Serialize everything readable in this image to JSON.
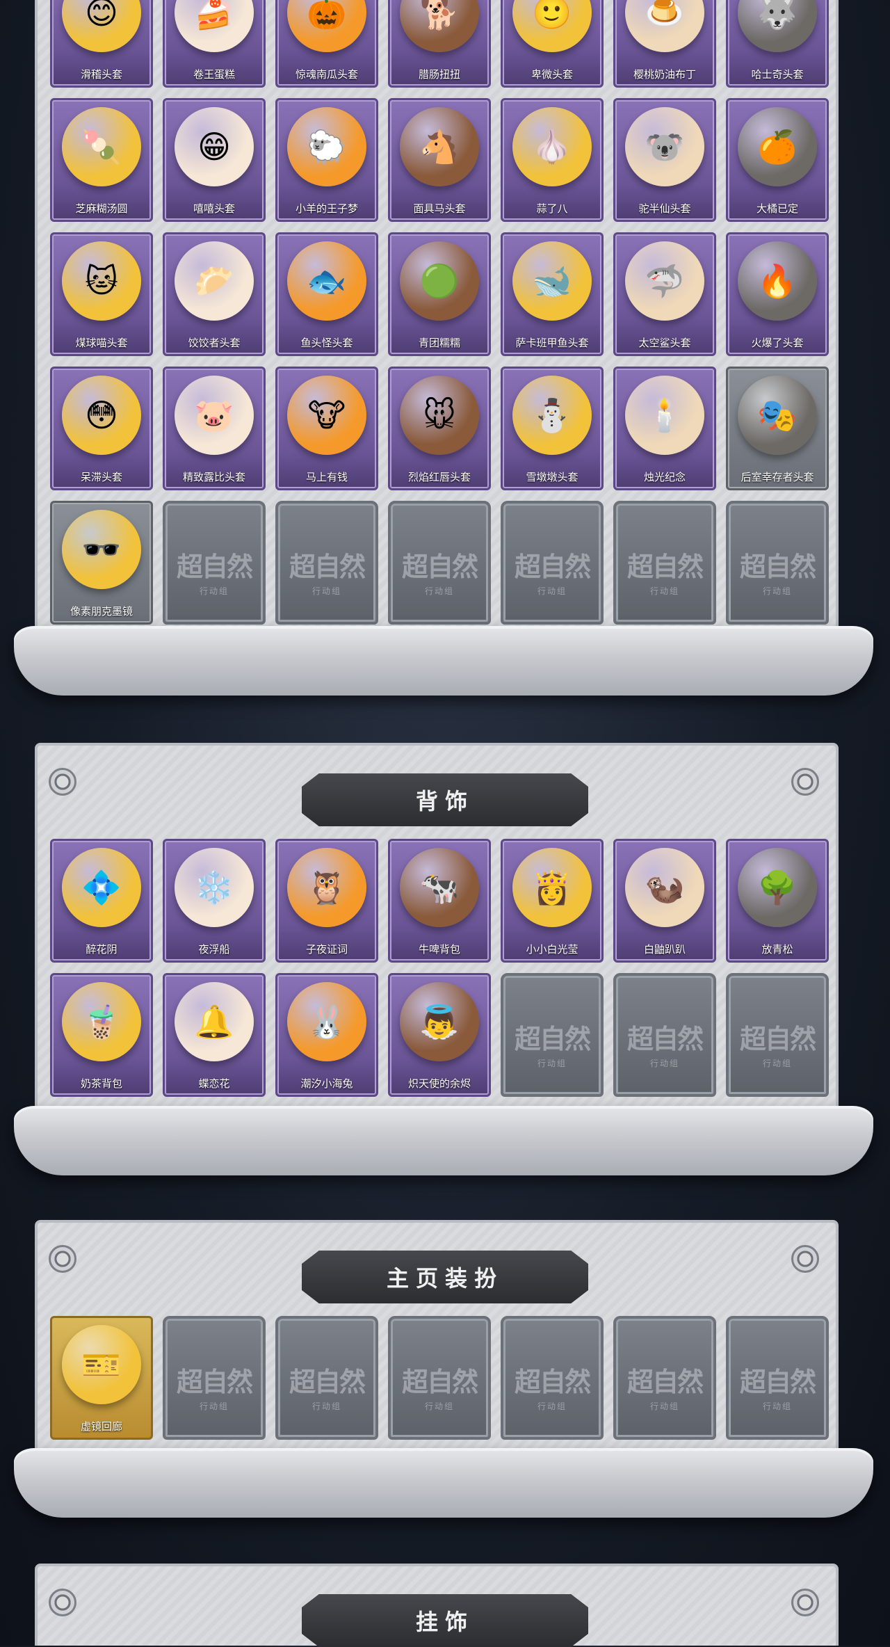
{
  "sections": {
    "backpack_title": "背饰",
    "homepage_title": "主页装扮",
    "pendant_title": "挂饰"
  },
  "watermark": {
    "main": "超自然",
    "sub": "行动组"
  },
  "headwear": [
    {
      "label": "滑稽头套",
      "icon": "😊",
      "style": "purple"
    },
    {
      "label": "卷王蛋糕",
      "icon": "🍰",
      "style": "purple"
    },
    {
      "label": "惊魂南瓜头套",
      "icon": "🎃",
      "style": "purple"
    },
    {
      "label": "腊肠扭扭",
      "icon": "🐕",
      "style": "purple"
    },
    {
      "label": "卑微头套",
      "icon": "🙂",
      "style": "purple"
    },
    {
      "label": "樱桃奶油布丁",
      "icon": "🍮",
      "style": "purple"
    },
    {
      "label": "哈士奇头套",
      "icon": "🐺",
      "style": "purple"
    },
    {
      "label": "芝麻糊汤圆",
      "icon": "🍡",
      "style": "purple"
    },
    {
      "label": "嘻嘻头套",
      "icon": "😁",
      "style": "purple"
    },
    {
      "label": "小羊的王子梦",
      "icon": "🐑",
      "style": "purple"
    },
    {
      "label": "面具马头套",
      "icon": "🐴",
      "style": "purple"
    },
    {
      "label": "蒜了八",
      "icon": "🧄",
      "style": "purple"
    },
    {
      "label": "驼半仙头套",
      "icon": "🐨",
      "style": "purple"
    },
    {
      "label": "大橘已定",
      "icon": "🍊",
      "style": "purple"
    },
    {
      "label": "煤球喵头套",
      "icon": "🐱",
      "style": "purple"
    },
    {
      "label": "饺饺者头套",
      "icon": "🥟",
      "style": "purple"
    },
    {
      "label": "鱼头怪头套",
      "icon": "🐟",
      "style": "purple"
    },
    {
      "label": "青团糯糯",
      "icon": "🟢",
      "style": "purple"
    },
    {
      "label": "萨卡班甲鱼头套",
      "icon": "🐋",
      "style": "purple"
    },
    {
      "label": "太空鲨头套",
      "icon": "🦈",
      "style": "purple"
    },
    {
      "label": "火爆了头套",
      "icon": "🔥",
      "style": "purple"
    },
    {
      "label": "呆滞头套",
      "icon": "😳",
      "style": "purple"
    },
    {
      "label": "精致露比头套",
      "icon": "🐷",
      "style": "purple"
    },
    {
      "label": "马上有钱",
      "icon": "🐮",
      "style": "purple"
    },
    {
      "label": "烈焰红唇头套",
      "icon": "🐭",
      "style": "purple"
    },
    {
      "label": "雪墩墩头套",
      "icon": "⛄",
      "style": "purple"
    },
    {
      "label": "烛光纪念",
      "icon": "🕯️",
      "style": "purple"
    },
    {
      "label": "后室幸存者头套",
      "icon": "🎭",
      "style": "gray"
    },
    {
      "label": "像素朋克墨镜",
      "icon": "🕶️",
      "style": "gray"
    }
  ],
  "backpack": [
    {
      "label": "醉花阴",
      "icon": "💠"
    },
    {
      "label": "夜浮船",
      "icon": "❄️"
    },
    {
      "label": "子夜证词",
      "icon": "🦉"
    },
    {
      "label": "牛啤背包",
      "icon": "🐄"
    },
    {
      "label": "小小白光莹",
      "icon": "👸"
    },
    {
      "label": "白鼬趴趴",
      "icon": "🦦"
    },
    {
      "label": "放青松",
      "icon": "🌳"
    },
    {
      "label": "奶茶背包",
      "icon": "🧋"
    },
    {
      "label": "蝶恋花",
      "icon": "🔔"
    },
    {
      "label": "潮汐小海兔",
      "icon": "🐰"
    },
    {
      "label": "炽天使的余烬",
      "icon": "👼"
    }
  ],
  "homepage": [
    {
      "label": "虚镜回廊",
      "icon": "🎫"
    }
  ]
}
